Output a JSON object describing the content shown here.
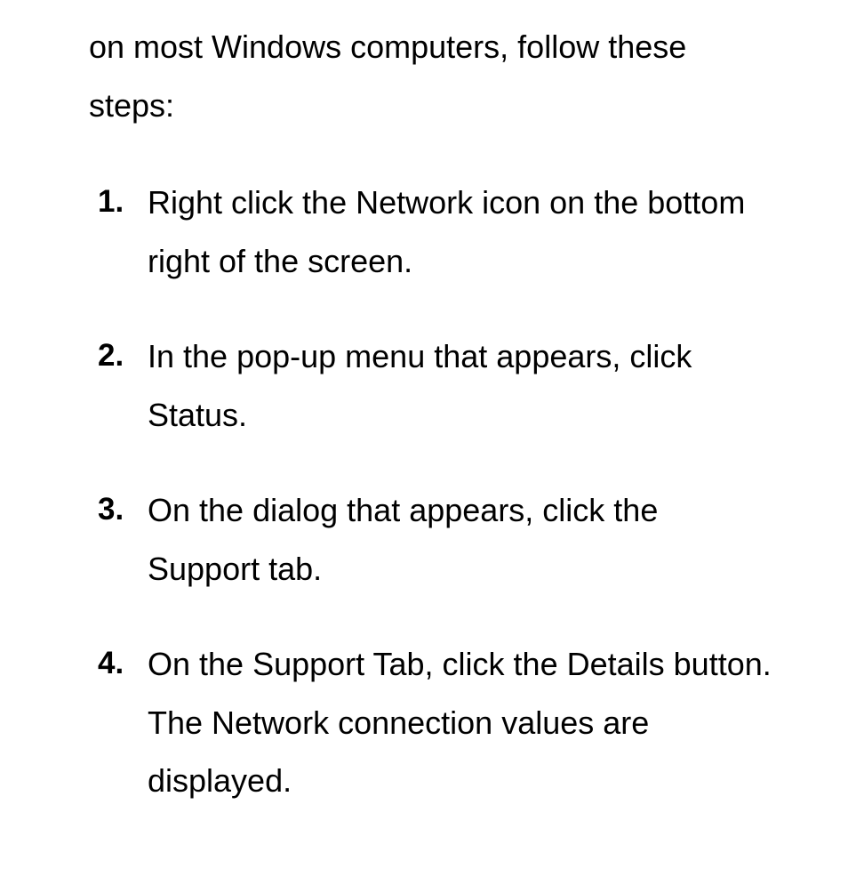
{
  "intro": "on most Windows computers, follow these steps:",
  "steps": [
    "Right click the Network icon on the bottom right of the screen.",
    "In the pop-up menu that appears, click Status.",
    "On the dialog that appears, click the Support tab.",
    "On the Support Tab, click the Details button. The Network connection values are displayed."
  ]
}
